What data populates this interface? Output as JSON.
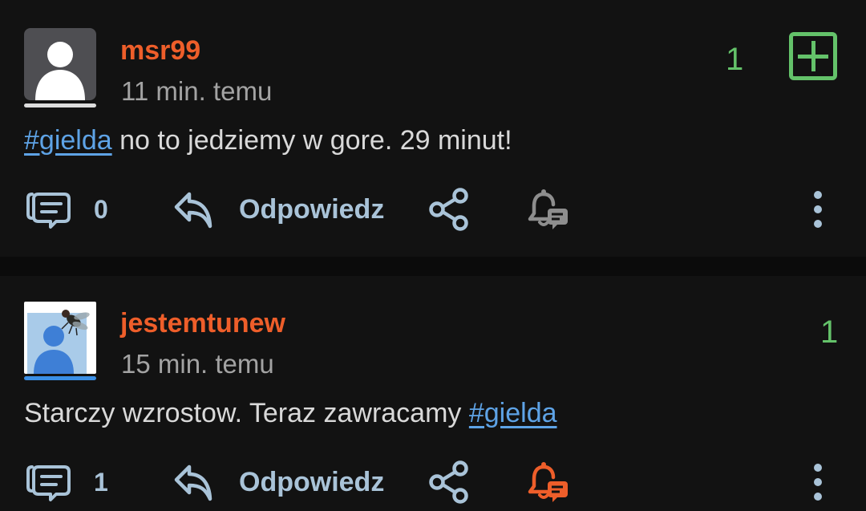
{
  "posts": [
    {
      "username": "msr99",
      "time": "11 min. temu",
      "votes": "1",
      "tag": "#gielda",
      "text": " no to jedziemy w gore. 29 minut!",
      "comments": "0",
      "reply_label": "Odpowiedz",
      "avatar": "default-user-avatar",
      "avatar_bar_color": "#dddddd",
      "bell_color": "#8e8e8e"
    },
    {
      "username": "jestemtunew",
      "time": "15 min. temu",
      "votes": "1",
      "text": "Starczy wzrostow. Teraz zawracamy ",
      "tag": "#gielda",
      "comments": "1",
      "reply_label": "Odpowiedz",
      "avatar": "fly-on-user-avatar",
      "avatar_bar_color": "#3a8fe6",
      "bell_color": "#ee5e2a"
    }
  ],
  "colors": {
    "background": "#121212",
    "username": "#ee5e2a",
    "tag": "#5ea3e6",
    "vote": "#64c26a",
    "action": "#a9c3d8"
  }
}
